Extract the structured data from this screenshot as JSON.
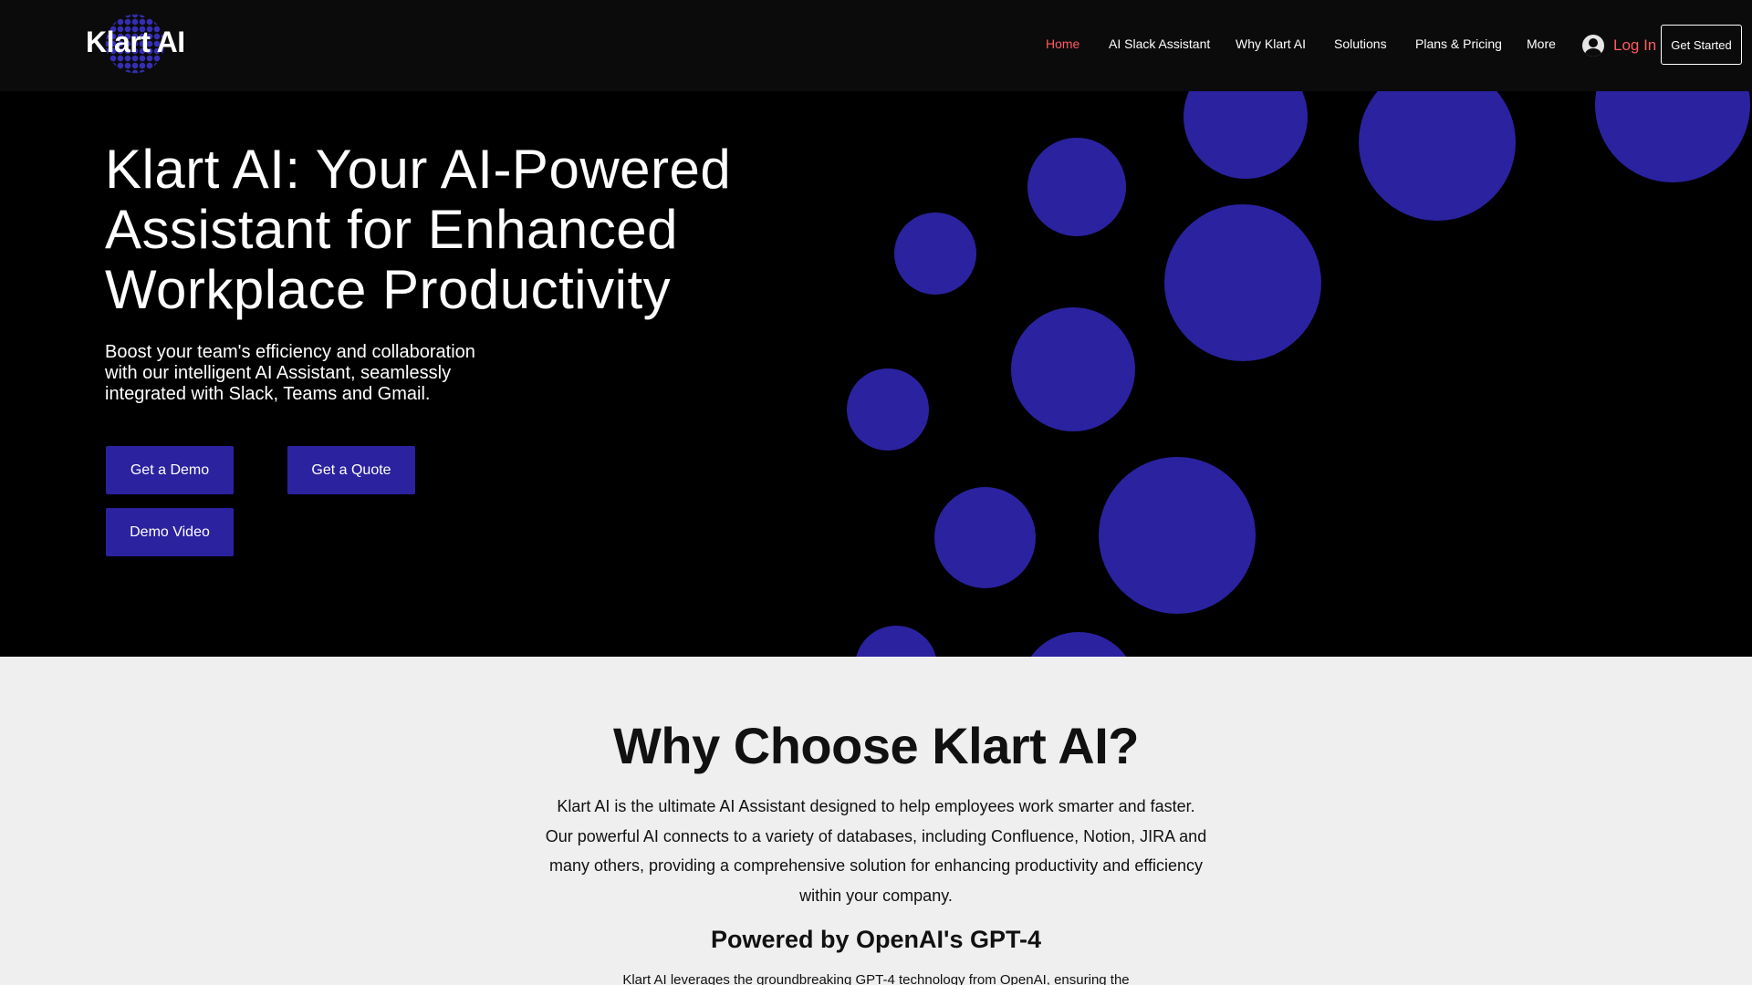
{
  "brand": {
    "name": "Klart AI",
    "accent": "#2b22a0",
    "active_nav": "#ff5a5f"
  },
  "nav": {
    "items": [
      {
        "label": "Home",
        "active": true
      },
      {
        "label": "AI Slack Assistant"
      },
      {
        "label": "Why Klart AI"
      },
      {
        "label": "Solutions"
      },
      {
        "label": "Plans & Pricing"
      },
      {
        "label": "More"
      }
    ],
    "login_label": "Log In",
    "login_icon": "user-avatar-icon",
    "get_started_label": "Get Started"
  },
  "hero": {
    "title": "Klart AI: Your AI-Powered Assistant for Enhanced Workplace Productivity",
    "subtitle": "Boost your team's efficiency and collaboration with our intelligent AI Assistant, seamlessly integrated with Slack, Teams and Gmail.",
    "buttons": {
      "demo": "Get a Demo",
      "quote": "Get a Quote",
      "video": "Demo Video"
    }
  },
  "why": {
    "title": "Why Choose Klart AI?",
    "text": "Klart AI is the ultimate AI Assistant designed to help employees work smarter and faster. Our powerful AI connects to a variety of databases, including Confluence, Notion, JIRA and many others, providing a comprehensive solution for enhancing productivity and efficiency within your company.",
    "powered_by": "Powered by OpenAI's GPT-4",
    "leverage_text": "Klart AI leverages the groundbreaking GPT-4 technology from OpenAI, ensuring the"
  }
}
